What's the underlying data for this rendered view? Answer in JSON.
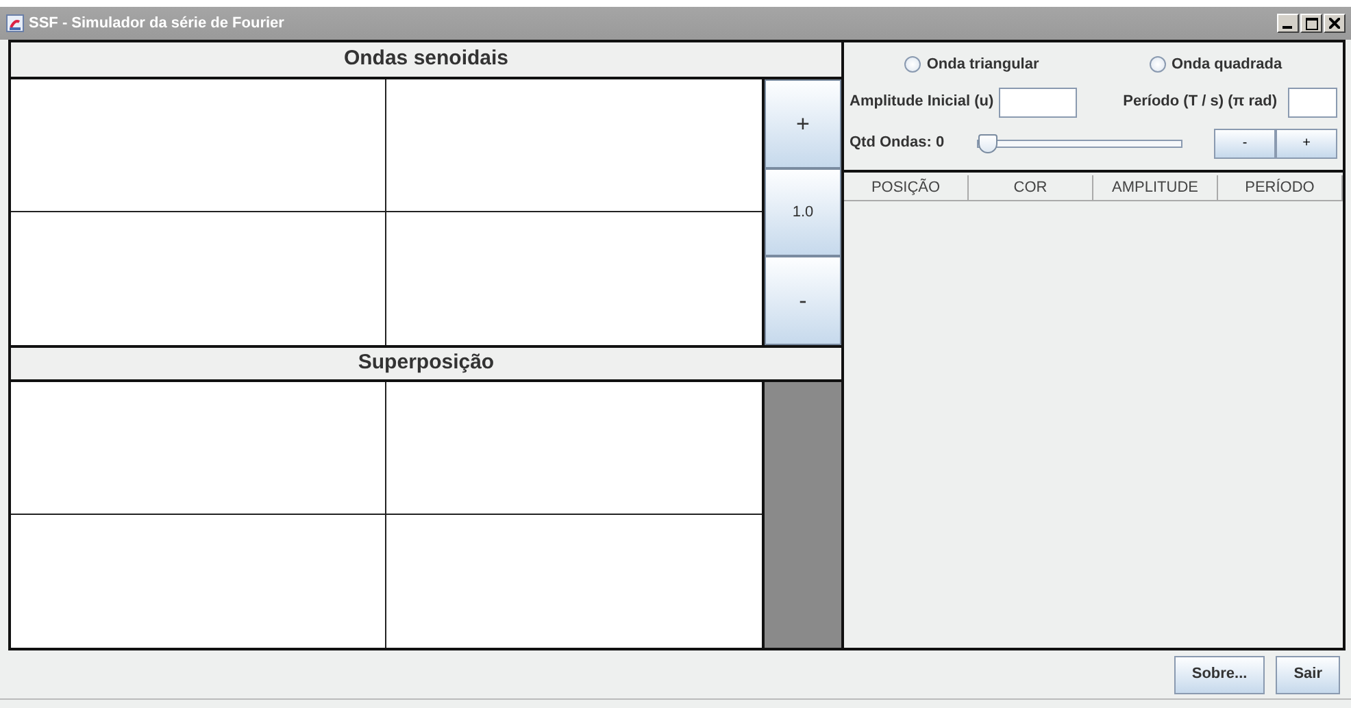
{
  "window": {
    "title": "SSF - Simulador da série de Fourier"
  },
  "sine_waves": {
    "title": "Ondas senoidais",
    "zoom_buttons": [
      "+",
      "1.0",
      "-"
    ]
  },
  "superposition": {
    "title": "Superposição"
  },
  "wave_types": [
    {
      "label": "Onda triangular",
      "selected": false
    },
    {
      "label": "Onda quadrada",
      "selected": false
    }
  ],
  "amplitude": {
    "label": "Amplitude Inicial (u)"
  },
  "period": {
    "label": "Período (T / s) (π rad)"
  },
  "wave_count": {
    "label": "Qtd Ondas: 0",
    "level": 0
  },
  "step_buttons": [
    "-",
    "+"
  ],
  "table": {
    "columns": [
      "POSIÇÃO",
      "COR",
      "AMPLITUDE",
      "PERÍODO"
    ]
  },
  "buttons": [
    "Sobre...",
    "Sair"
  ]
}
